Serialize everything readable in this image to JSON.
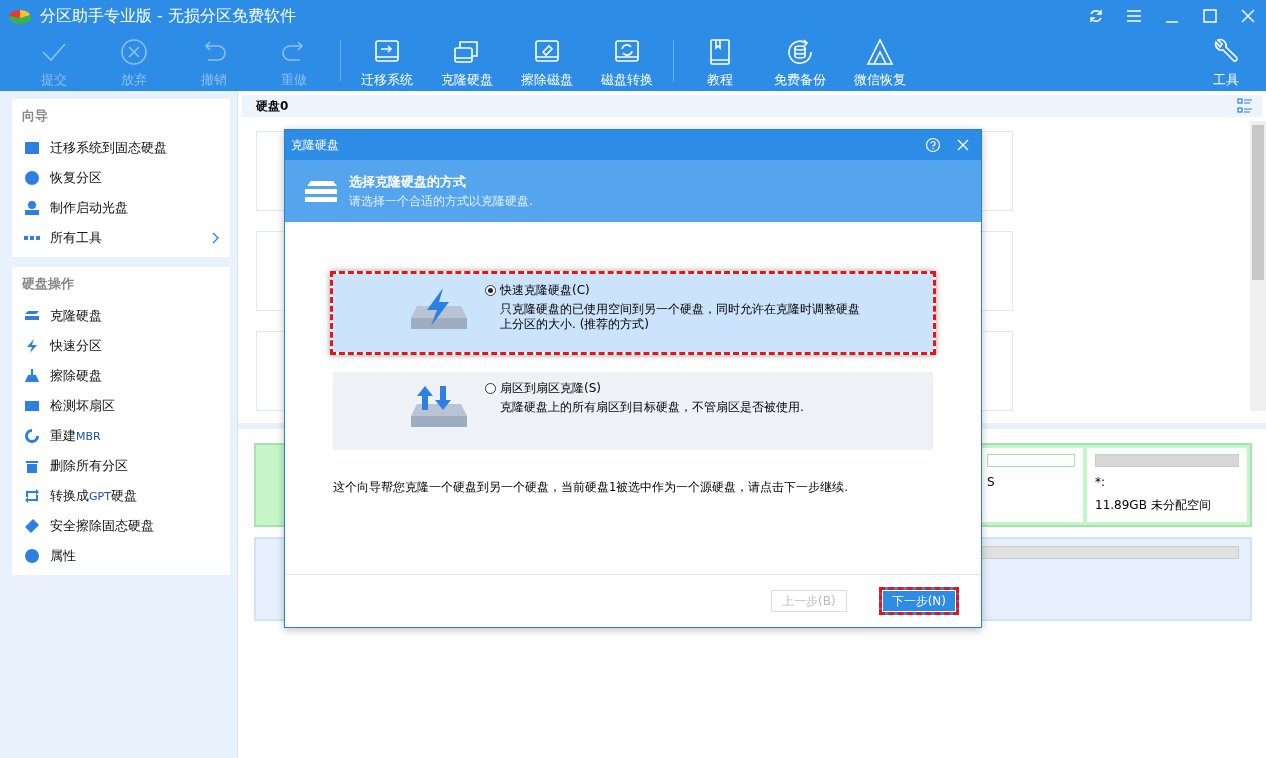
{
  "window": {
    "title": "分区助手专业版 - 无损分区免费软件"
  },
  "toolbar": {
    "items": [
      {
        "label": "提交",
        "disabled": true
      },
      {
        "label": "放弃",
        "disabled": true
      },
      {
        "label": "撤销",
        "disabled": true
      },
      {
        "label": "重做",
        "disabled": true
      },
      {
        "label": "迁移系统",
        "disabled": false
      },
      {
        "label": "克隆硬盘",
        "disabled": false
      },
      {
        "label": "擦除磁盘",
        "disabled": false
      },
      {
        "label": "磁盘转换",
        "disabled": false
      },
      {
        "label": "教程",
        "disabled": false
      },
      {
        "label": "免费备份",
        "disabled": false
      },
      {
        "label": "微信恢复",
        "disabled": false
      }
    ],
    "tools": {
      "label": "工具"
    }
  },
  "sidebar": {
    "sections": [
      {
        "title": "向导",
        "items": [
          {
            "parts": [
              {
                "text": "迁移系统到固态硬盘",
                "kind": "cjk"
              }
            ],
            "has_arrow": false
          },
          {
            "parts": [
              {
                "text": "恢复分区",
                "kind": "cjk"
              }
            ],
            "has_arrow": false
          },
          {
            "parts": [
              {
                "text": "制作启动光盘",
                "kind": "cjk"
              }
            ],
            "has_arrow": false
          },
          {
            "parts": [
              {
                "text": "所有工具",
                "kind": "cjk"
              }
            ],
            "has_arrow": true
          }
        ]
      },
      {
        "title": "硬盘操作",
        "items": [
          {
            "parts": [
              {
                "text": "克隆硬盘",
                "kind": "cjk"
              }
            ],
            "has_arrow": false
          },
          {
            "parts": [
              {
                "text": "快速分区",
                "kind": "cjk"
              }
            ],
            "has_arrow": false
          },
          {
            "parts": [
              {
                "text": "擦除硬盘",
                "kind": "cjk"
              }
            ],
            "has_arrow": false
          },
          {
            "parts": [
              {
                "text": "检测坏扇区",
                "kind": "cjk"
              }
            ],
            "has_arrow": false
          },
          {
            "parts": [
              {
                "text": "重建",
                "kind": "cjk"
              },
              {
                "text": "MBR",
                "kind": "latin"
              }
            ],
            "has_arrow": false
          },
          {
            "parts": [
              {
                "text": "删除所有分区",
                "kind": "cjk"
              }
            ],
            "has_arrow": false
          },
          {
            "parts": [
              {
                "text": "转换成",
                "kind": "cjk"
              },
              {
                "text": "GPT",
                "kind": "latin"
              },
              {
                "text": "硬盘",
                "kind": "cjk"
              }
            ],
            "has_arrow": false
          },
          {
            "parts": [
              {
                "text": "安全擦除固态硬盘",
                "kind": "cjk"
              }
            ],
            "has_arrow": false
          },
          {
            "parts": [
              {
                "text": "属性",
                "kind": "cjk"
              }
            ],
            "has_arrow": false
          }
        ]
      }
    ]
  },
  "disk_panel": {
    "title": "硬盘0"
  },
  "disk_map": {
    "partition_fragment": "S",
    "unallocated": {
      "letter": "*:",
      "size": "11.89GB 未分配空间"
    }
  },
  "dialog": {
    "title": "克隆硬盘",
    "header": {
      "title": "选择克隆硬盘的方式",
      "subtitle": "请选择一个合适的方式以克隆硬盘."
    },
    "options": [
      {
        "label": "快速克隆硬盘(C)",
        "description": "只克隆硬盘的已使用空间到另一个硬盘，同时允许在克隆时调整硬盘上分区的大小. (推荐的方式)",
        "selected": true
      },
      {
        "label": "扇区到扇区克隆(S)",
        "description": "克隆硬盘上的所有扇区到目标硬盘，不管扇区是否被使用.",
        "selected": false
      }
    ],
    "note": "这个向导帮您克隆一个硬盘到另一个硬盘，当前硬盘1被选中作为一个源硬盘，请点击下一步继续.",
    "buttons": [
      {
        "label": "上一步(B)",
        "disabled": true,
        "highlighted": false
      },
      {
        "label": "下一步(N)",
        "disabled": false,
        "highlighted": true
      }
    ]
  }
}
